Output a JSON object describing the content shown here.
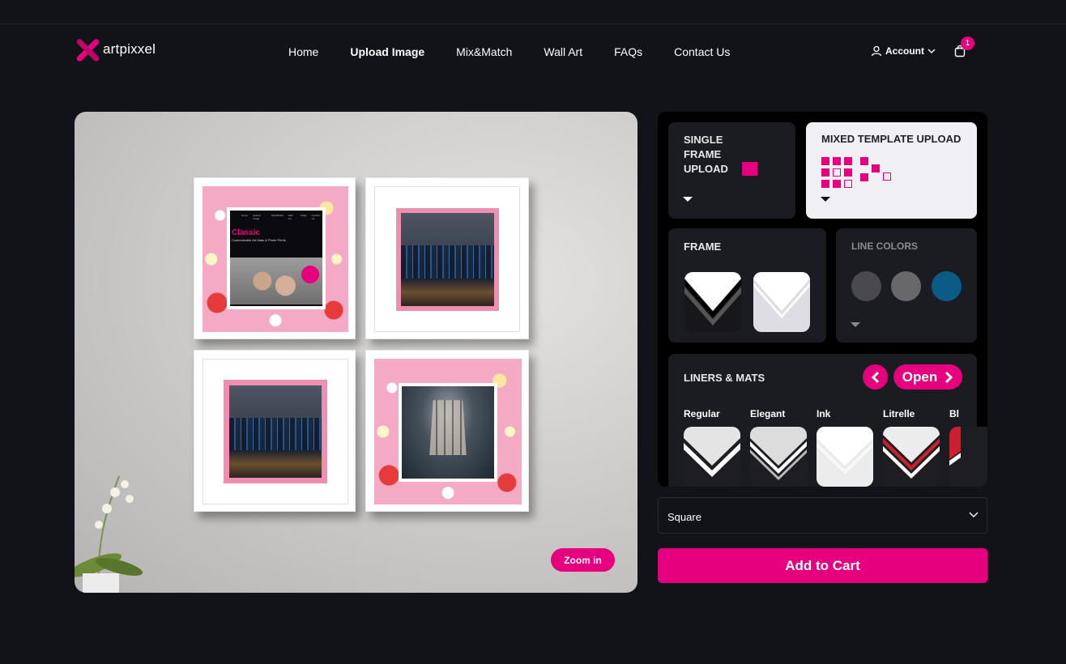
{
  "brand": {
    "name": "artpixxel",
    "accent": "#e6007e"
  },
  "nav": {
    "items": [
      {
        "label": "Home",
        "active": false
      },
      {
        "label": "Upload Image",
        "active": true
      },
      {
        "label": "Mix&Match",
        "active": false
      },
      {
        "label": "Wall Art",
        "active": false
      },
      {
        "label": "FAQs",
        "active": false
      },
      {
        "label": "Contact Us",
        "active": false
      }
    ],
    "account_label": "Account",
    "cart_count": "1"
  },
  "preview": {
    "zoom_label": "Zoom in",
    "frame1": {
      "title": "Classic",
      "subtitle": "Customizable Art Mats & Photo Prints",
      "menu": [
        "Home",
        "Upload Image",
        "Mix&Match",
        "Wall Art",
        "FAQs",
        "Contact Us"
      ]
    }
  },
  "upload": {
    "single": {
      "lines": [
        "SINGLE",
        "FRAME",
        "UPLOAD"
      ]
    },
    "mixed": {
      "label": "MIXED TEMPLATE UPLOAD"
    }
  },
  "frame_section": {
    "title": "FRAME"
  },
  "line_colors": {
    "title": "LINE COLORS",
    "colors": [
      "#4a4a4e",
      "#68686b",
      "#0a5b85"
    ]
  },
  "liners": {
    "title": "LINERS & MATS",
    "open_label": "Open",
    "options": [
      {
        "label": "Regular"
      },
      {
        "label": "Elegant"
      },
      {
        "label": "Ink"
      },
      {
        "label": "Litrelle"
      },
      {
        "label": "Bl"
      }
    ]
  },
  "shape_select": {
    "value": "Square"
  },
  "add_to_cart_label": "Add to Cart"
}
